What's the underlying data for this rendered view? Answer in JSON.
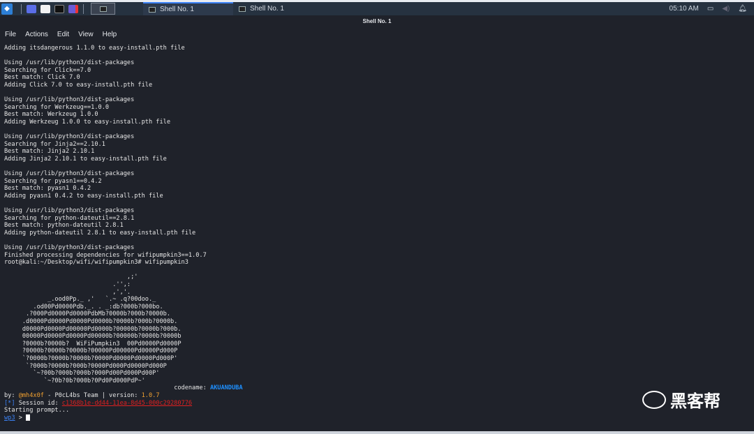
{
  "taskbar": {
    "tabs": [
      "Shell No. 1",
      "Shell No. 1"
    ],
    "clock": "05:10 AM"
  },
  "window": {
    "title": "Shell No. 1"
  },
  "menu": [
    "File",
    "Actions",
    "Edit",
    "View",
    "Help"
  ],
  "terminal": {
    "lines": [
      "Adding itsdangerous 1.1.0 to easy-install.pth file",
      "",
      "Using /usr/lib/python3/dist-packages",
      "Searching for Click==7.0",
      "Best match: Click 7.0",
      "Adding Click 7.0 to easy-install.pth file",
      "",
      "Using /usr/lib/python3/dist-packages",
      "Searching for Werkzeug==1.0.0",
      "Best match: Werkzeug 1.0.0",
      "Adding Werkzeug 1.0.0 to easy-install.pth file",
      "",
      "Using /usr/lib/python3/dist-packages",
      "Searching for Jinja2==2.10.1",
      "Best match: Jinja2 2.10.1",
      "Adding Jinja2 2.10.1 to easy-install.pth file",
      "",
      "Using /usr/lib/python3/dist-packages",
      "Searching for pyasn1==0.4.2",
      "Best match: pyasn1 0.4.2",
      "Adding pyasn1 0.4.2 to easy-install.pth file",
      "",
      "Using /usr/lib/python3/dist-packages",
      "Searching for python-dateutil==2.8.1",
      "Best match: python-dateutil 2.8.1",
      "Adding python-dateutil 2.8.1 to easy-install.pth file",
      "",
      "Using /usr/lib/python3/dist-packages",
      "Finished processing dependencies for wifipumpkin3==1.0.7",
      "root@kali:~/Desktop/wifi/wifipumpkin3# wifipumpkin3",
      ""
    ],
    "art": "                                  ,;'\n                              .'',:\n                              ,','.\n            _.ood0Pp._ ,'   `.~ .q?00doo._\n        .od00Pd0000Pdb._. . _:db?000b?000bo.\n      .?000Pd0000Pd0000PdbMb?0000b?000b?0000b.\n     .d0000Pd0000Pd0000Pd0000b?0000b?000b?0000b.\n     d0000Pd0000Pd00000Pd0000b?00000b?0000b?000b.\n     00000Pd0000Pd0000Pd00000b?00000b?0000b?0000b\n     ?0000b?0000b?  WiFiPumpkin3  00Pd0000Pd0000P\n     ?0000b?0000b?0000b?00000Pd00000Pd0000Pd000P\n     `?0000b?0000b?0000b?0000Pd0000Pd0000Pd000P'\n      `?000b?0000b?000b?0000Pd000Pd0000Pd000P\n        `~?00b?000b?000b?000Pd00Pd000Pd00P'\n           `~?0b?0b?000b?0Pd0Pd000PdP~'",
    "codename_label": "codename: ",
    "codename": "AKUANDUBA",
    "by_label": "by: ",
    "author": "@mh4x0f",
    "team": " - P0cL4bs Team | version: ",
    "version": "1.0.7",
    "session_bracket": "[*]",
    "session_label": " Session id: ",
    "session_id": "c1368b1e-dd44-11ea-8d45-000c29280776",
    "starting": "Starting prompt...",
    "prompt": "wp3",
    " prompt_sep": " > "
  },
  "watermark": "黑客帮"
}
